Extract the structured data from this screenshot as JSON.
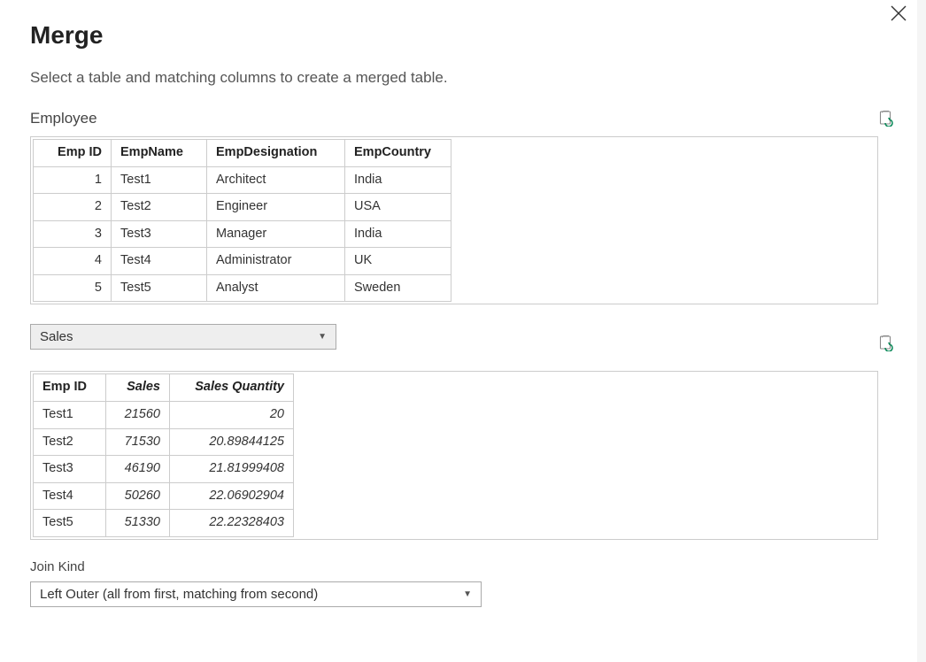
{
  "dialog": {
    "title": "Merge",
    "subtitle": "Select a table and matching columns to create a merged table."
  },
  "table1": {
    "name": "Employee",
    "headers": {
      "empId": "Emp ID",
      "empName": "EmpName",
      "empDes": "EmpDesignation",
      "empCtry": "EmpCountry"
    },
    "rows": [
      {
        "empId": "1",
        "empName": "Test1",
        "empDes": "Architect",
        "empCtry": "India"
      },
      {
        "empId": "2",
        "empName": "Test2",
        "empDes": "Engineer",
        "empCtry": "USA"
      },
      {
        "empId": "3",
        "empName": "Test3",
        "empDes": "Manager",
        "empCtry": "India"
      },
      {
        "empId": "4",
        "empName": "Test4",
        "empDes": "Administrator",
        "empCtry": "UK"
      },
      {
        "empId": "5",
        "empName": "Test5",
        "empDes": "Analyst",
        "empCtry": "Sweden"
      }
    ]
  },
  "table2": {
    "selector_value": "Sales",
    "headers": {
      "empId": "Emp ID",
      "sales": "Sales",
      "qty": "Sales Quantity"
    },
    "rows": [
      {
        "empId": "Test1",
        "sales": "21560",
        "qty": "20"
      },
      {
        "empId": "Test2",
        "sales": "71530",
        "qty": "20.89844125"
      },
      {
        "empId": "Test3",
        "sales": "46190",
        "qty": "21.81999408"
      },
      {
        "empId": "Test4",
        "sales": "50260",
        "qty": "22.06902904"
      },
      {
        "empId": "Test5",
        "sales": "51330",
        "qty": "22.22328403"
      }
    ]
  },
  "join": {
    "label": "Join Kind",
    "value": "Left Outer (all from first, matching from second)"
  }
}
